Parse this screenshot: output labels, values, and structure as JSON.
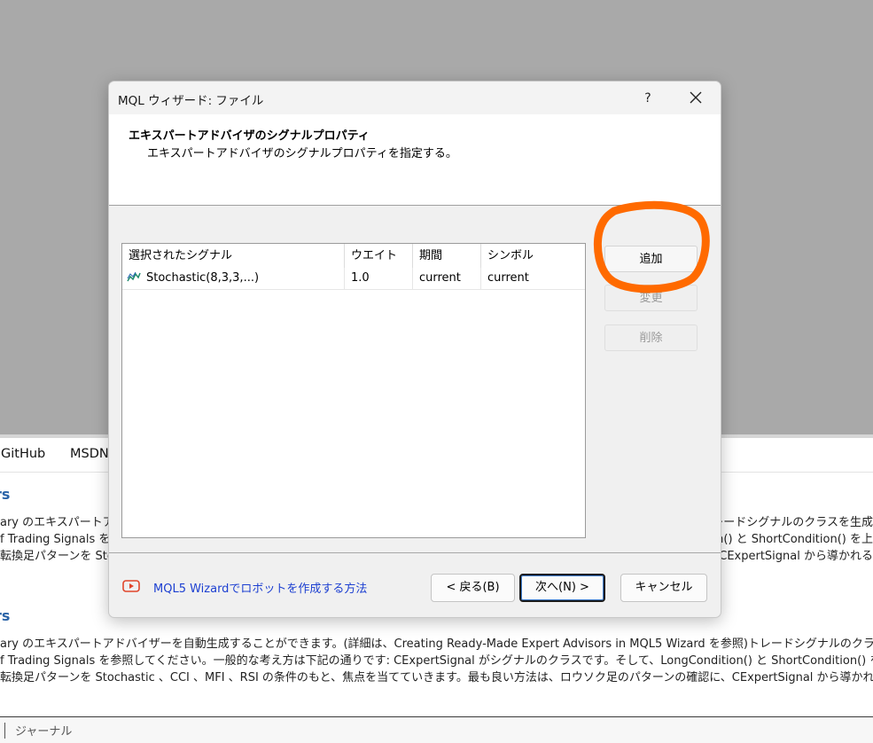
{
  "background": {
    "tabs": [
      "GitHub",
      "MSDN"
    ],
    "headings": [
      "rs",
      "rs"
    ],
    "lines_left": [
      "ary のエキスパートアド",
      "f Trading Signals を",
      "転換足パターンを Sto"
    ],
    "lines_right": [
      "i)トレードシグナルのクラスを生成",
      "on() と ShortCondition() を上",
      "CExpertSignal から導かれる"
    ],
    "full_lines": [
      "ary のエキスパートアドバイザーを自動生成することができます。(詳細は、Creating Ready-Made Expert Advisors in MQL5 Wizard を参照)トレードシグナルのクラスを生成",
      "f Trading Signals を参照してください。一般的な考え方は下記の通りです: CExpertSignal がシグナルのクラスです。そして、LongCondition() と ShortCondition() を上",
      "転換足パターンを Stochastic 、CCI 、MFI 、RSI の条件のもと、焦点を当てていきます。最も良い方法は、ロウソク足のパターンの確認に、CExpertSignal から導かれる"
    ],
    "status_text": "ジャーナル"
  },
  "dialog": {
    "title": "MQL ウィザード: ファイル",
    "help_label": "?",
    "header_title": "エキスパートアドバイザのシグナルプロパティ",
    "header_subtitle": "エキスパートアドバイザのシグナルプロパティを指定する。",
    "columns": [
      "選択されたシグナル",
      "ウエイト",
      "期間",
      "シンボル"
    ],
    "rows": [
      {
        "signal": "Stochastic(8,3,3,...)",
        "weight": "1.0",
        "period": "current",
        "symbol": "current"
      }
    ],
    "buttons": {
      "add": "追加",
      "modify": "変更",
      "delete": "削除",
      "back": "< 戻る(B)",
      "next": "次へ(N) >",
      "cancel": "キャンセル"
    },
    "link_text": "MQL5 Wizardでロボットを作成する方法",
    "accent_color": "#ff6a00",
    "link_color": "#1c3fd1"
  }
}
